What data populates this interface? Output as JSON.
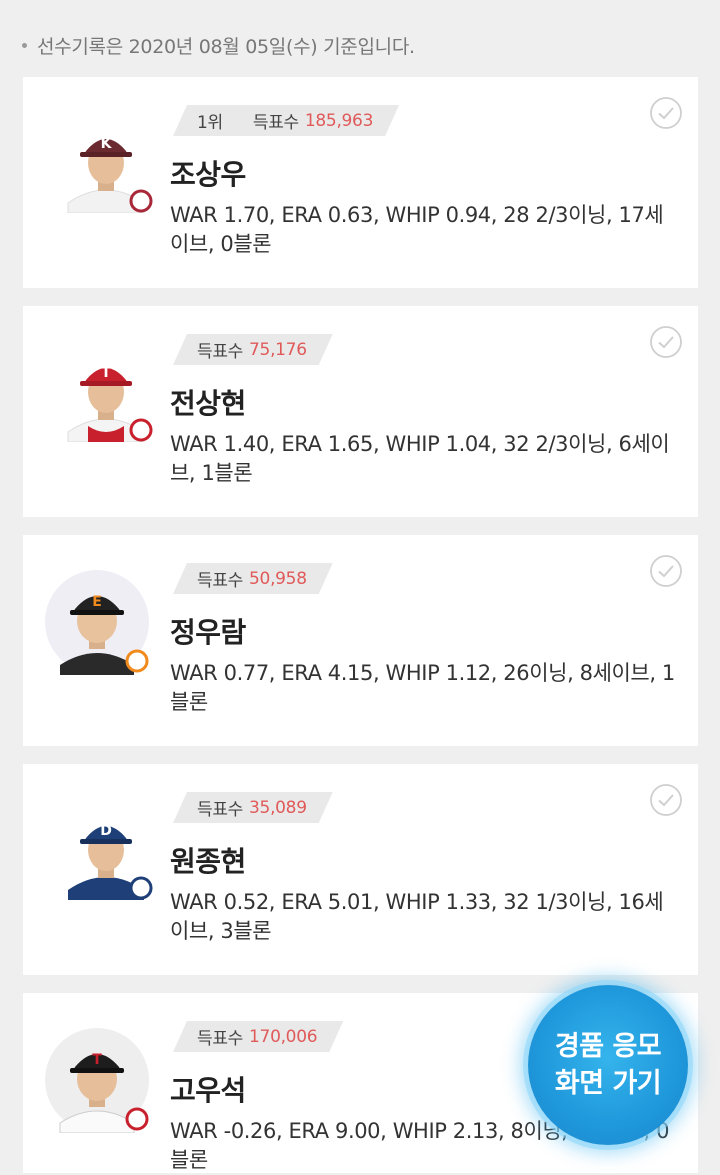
{
  "notice": "선수기록은 2020년 08월 05일(수) 기준입니다.",
  "vote_label": "득표수",
  "players": [
    {
      "rank": "1위",
      "votes": "185,963",
      "name": "조상우",
      "stats": "WAR 1.70, ERA 0.63, WHIP 0.94, 28 2/3이닝, 17세이브, 0블론",
      "cap_color": "#6a2a2f",
      "cap_letter": "K"
    },
    {
      "rank": "",
      "votes": "75,176",
      "name": "전상현",
      "stats": "WAR 1.40, ERA 1.65, WHIP 1.04, 32 2/3이닝, 6세이브, 1블론",
      "cap_color": "#c8202c",
      "cap_letter": "T"
    },
    {
      "rank": "",
      "votes": "50,958",
      "name": "정우람",
      "stats": "WAR 0.77, ERA 4.15, WHIP 1.12, 26이닝, 8세이브, 1블론",
      "cap_color": "#222222",
      "cap_letter": "E"
    },
    {
      "rank": "",
      "votes": "35,089",
      "name": "원종현",
      "stats": "WAR 0.52, ERA 5.01, WHIP 1.33, 32 1/3이닝, 16세이브, 3블론",
      "cap_color": "#1e3f77",
      "cap_letter": "D"
    },
    {
      "rank": "",
      "votes": "170,006",
      "name": "고우석",
      "stats": "WAR -0.26, ERA 9.00, WHIP 2.13, 8이닝, 3세이브, 0블론",
      "cap_color": "#1d1d1d",
      "cap_letter": "T"
    }
  ],
  "cta": {
    "line1": "경품 응모",
    "line2": "화면 가기"
  }
}
